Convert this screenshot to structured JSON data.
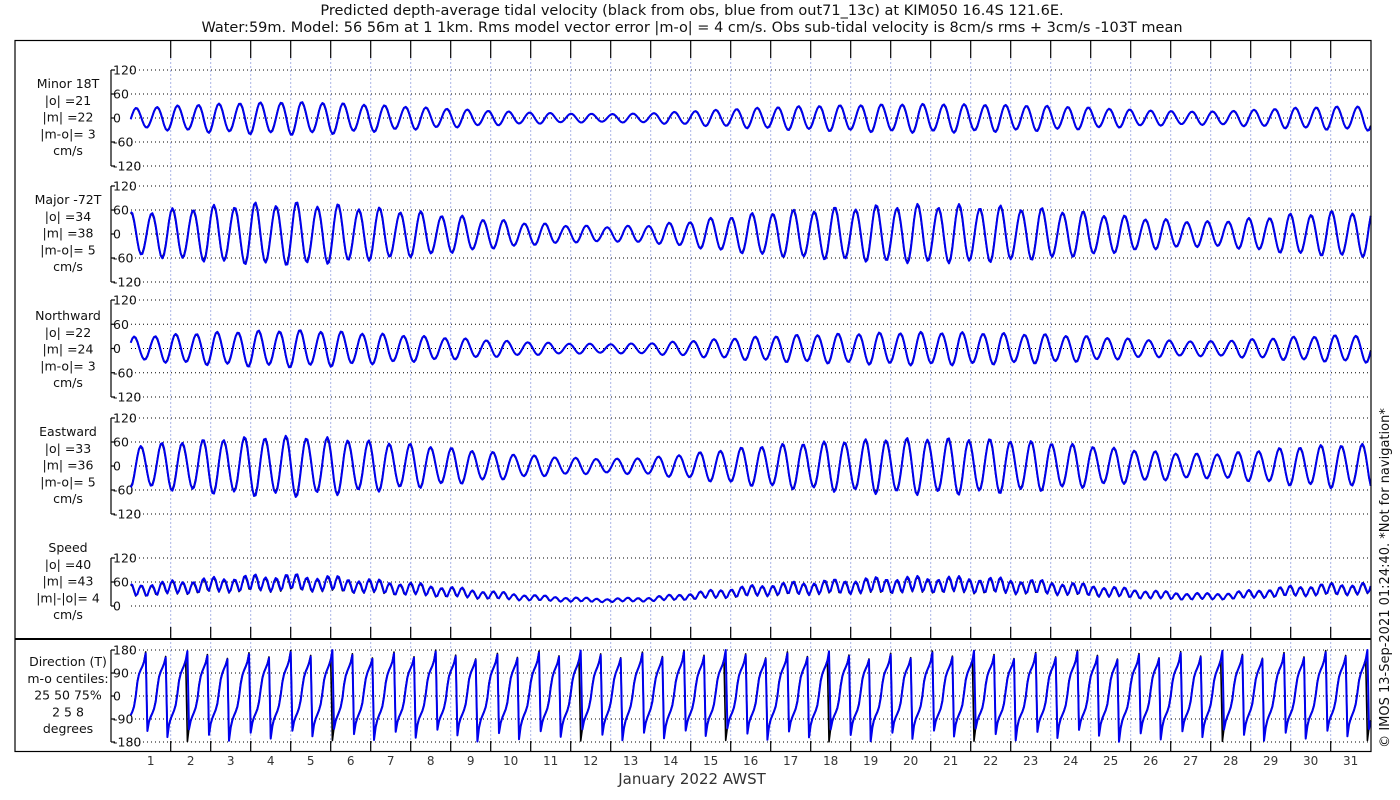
{
  "title": {
    "line1": "Predicted depth-average tidal velocity (black from obs, blue from out71_13c) at KIM050 16.4S 121.6E.",
    "line2": "Water:59m. Model: 56 56m at 1 1km. Rms model vector error |m-o| = 4 cm/s. Obs sub-tidal velocity is 8cm/s rms + 3cm/s -103T mean"
  },
  "side_note": "© IMOS 13-Sep-2021 01:24:40. *Not for navigation*",
  "chart_data": {
    "type": "line",
    "xlabel": "January 2022 AWST",
    "x_ticks": [
      "1",
      "2",
      "3",
      "4",
      "5",
      "6",
      "7",
      "8",
      "9",
      "10",
      "11",
      "12",
      "13",
      "14",
      "15",
      "16",
      "17",
      "18",
      "19",
      "20",
      "21",
      "22",
      "23",
      "24",
      "25",
      "26",
      "27",
      "28",
      "29",
      "30",
      "31"
    ],
    "x_range_days": [
      1,
      32
    ],
    "series_legend": {
      "obs": "black",
      "model": "blue"
    },
    "colors": {
      "obs": "#000000",
      "model": "#0000ee",
      "grid_vertical": "#aab4e6"
    },
    "tide_period_hours": 12.42,
    "major_axis_deg_T": -72,
    "minor_axis_deg_T": 18,
    "envelope_days": [
      1,
      2,
      3,
      4,
      5,
      6,
      7,
      8,
      9,
      10,
      11,
      12,
      13,
      14,
      15,
      16,
      17,
      18,
      19,
      20,
      21,
      22,
      23,
      24,
      25,
      26,
      27,
      28,
      29,
      30,
      31,
      32
    ],
    "major_amplitude_cms": [
      52,
      60,
      68,
      74,
      76,
      72,
      64,
      56,
      46,
      36,
      27,
      21,
      18,
      22,
      32,
      44,
      54,
      60,
      65,
      70,
      71,
      70,
      66,
      60,
      52,
      42,
      34,
      30,
      38,
      48,
      54,
      56
    ],
    "minor_amplitude_cms": [
      24,
      30,
      35,
      38,
      40,
      38,
      33,
      28,
      23,
      18,
      14,
      11,
      10,
      12,
      17,
      22,
      27,
      30,
      32,
      34,
      35,
      34,
      32,
      30,
      26,
      21,
      17,
      16,
      20,
      25,
      28,
      30
    ],
    "obs_scale": 0.96,
    "panels": [
      {
        "key": "minor",
        "label_lines": [
          "Minor 18T",
          "|o| =21",
          "|m| =22",
          "|m-o|= 3",
          "cm/s"
        ],
        "ylim": [
          -120,
          120
        ],
        "yticks": [
          "120",
          "60",
          "0",
          "-60",
          "-120"
        ],
        "ytick_values": [
          120,
          60,
          0,
          -60,
          -120
        ]
      },
      {
        "key": "major",
        "label_lines": [
          "Major -72T",
          "|o| =34",
          "|m| =38",
          "|m-o|= 5",
          "cm/s"
        ],
        "ylim": [
          -120,
          120
        ],
        "yticks": [
          "120",
          "60",
          "0",
          "-60",
          "-120"
        ],
        "ytick_values": [
          120,
          60,
          0,
          -60,
          -120
        ]
      },
      {
        "key": "north",
        "label_lines": [
          "Northward",
          "|o| =22",
          "|m| =24",
          "|m-o|= 3",
          "cm/s"
        ],
        "ylim": [
          -120,
          120
        ],
        "yticks": [
          "120",
          "60",
          "0",
          "-60",
          "-120"
        ],
        "ytick_values": [
          120,
          60,
          0,
          -60,
          -120
        ]
      },
      {
        "key": "east",
        "label_lines": [
          "Eastward",
          "|o| =33",
          "|m| =36",
          "|m-o|= 5",
          "cm/s"
        ],
        "ylim": [
          -120,
          120
        ],
        "yticks": [
          "120",
          "60",
          "0",
          "-60",
          "-120"
        ],
        "ytick_values": [
          120,
          60,
          0,
          -60,
          -120
        ]
      },
      {
        "key": "speed",
        "label_lines": [
          "Speed",
          "|o| =40",
          "|m| =43",
          "|m|-|o|= 4",
          "cm/s"
        ],
        "ylim": [
          0,
          120
        ],
        "yticks": [
          "120",
          "60",
          "0"
        ],
        "ytick_values": [
          120,
          60,
          0
        ]
      },
      {
        "key": "dir",
        "label_lines": [
          "Direction (T)",
          "m-o centiles:",
          "25  50  75%",
          "2  5  8",
          "degrees"
        ],
        "ylim": [
          -180,
          180
        ],
        "yticks": [
          "180",
          "90",
          "0",
          "-90",
          "-180"
        ],
        "ytick_values": [
          180,
          90,
          0,
          -90,
          -180
        ]
      }
    ]
  }
}
